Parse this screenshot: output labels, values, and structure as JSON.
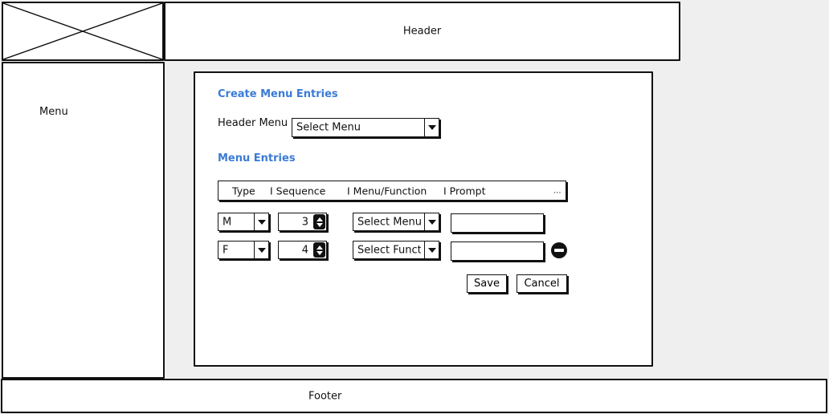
{
  "header": {
    "label": "Header"
  },
  "menu": {
    "label": "Menu"
  },
  "footer": {
    "label": "Footer"
  },
  "form": {
    "create_title": "Create Menu Entries",
    "header_menu_label": "Header Menu",
    "header_menu_select": "Select Menu",
    "entries_title": "Menu Entries",
    "columns": [
      "Type",
      "I Sequence",
      "I Menu/Function",
      "I Prompt",
      "..."
    ],
    "rows": [
      {
        "type": "M",
        "sequence": "3",
        "menu_function": "Select Menu",
        "prompt": ""
      },
      {
        "type": "F",
        "sequence": "4",
        "menu_function": "Select Functic",
        "prompt": ""
      }
    ],
    "save_label": "Save",
    "cancel_label": "Cancel"
  },
  "icons": {
    "logo": "image-placeholder-icon",
    "dropdown": "chevron-down-icon",
    "stepper": "spinner-icon",
    "remove": "remove-row-icon"
  }
}
